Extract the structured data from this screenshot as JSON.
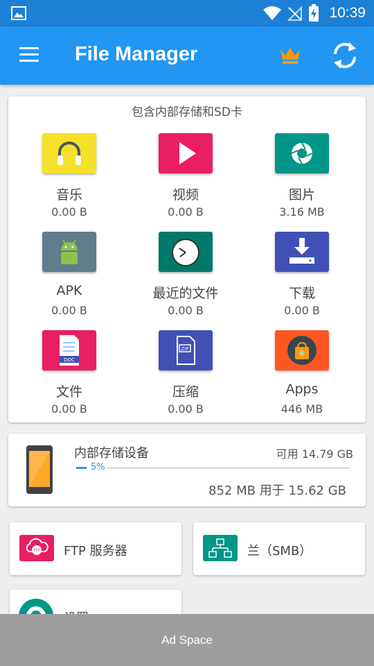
{
  "status_bar": {
    "time": "10:39"
  },
  "app_bar": {
    "title": "File Manager"
  },
  "categories": {
    "heading": "包含内部存储和SD卡",
    "items": [
      {
        "name": "音乐",
        "size": "0.00 B",
        "icon": "headphones-icon",
        "color": "#f5e12a"
      },
      {
        "name": "视频",
        "size": "0.00 B",
        "icon": "play-icon",
        "color": "#e91e63"
      },
      {
        "name": "图片",
        "size": "3.16 MB",
        "icon": "camera-shutter-icon",
        "color": "#009688"
      },
      {
        "name": "APK",
        "size": "0.00 B",
        "icon": "android-icon",
        "color": "#607d8b"
      },
      {
        "name": "最近的文件",
        "size": "0.00 B",
        "icon": "clock-icon",
        "color": "#00796b"
      },
      {
        "name": "下载",
        "size": "0.00 B",
        "icon": "download-icon",
        "color": "#3f51b5"
      },
      {
        "name": "文件",
        "size": "0.00 B",
        "icon": "document-icon",
        "color": "#e91e63"
      },
      {
        "name": "压缩",
        "size": "0.00 B",
        "icon": "zip-icon",
        "color": "#3f51b5"
      },
      {
        "name": "Apps",
        "size": "446 MB",
        "icon": "apps-icon",
        "color": "#ff5722"
      }
    ]
  },
  "storage": {
    "name": "内部存储设备",
    "available": "可用 14.79 GB",
    "percent_label": "5%",
    "percent_value": 5,
    "used": "852 MB 用于 15.62 GB"
  },
  "shortcuts": {
    "ftp": {
      "label": "FTP 服务器",
      "icon": "ftp-cloud-icon",
      "color": "#e91e63"
    },
    "smb": {
      "label": "兰（SMB）",
      "icon": "network-icon",
      "color": "#009688"
    },
    "settings": {
      "label": "设置",
      "icon": "gear-icon",
      "color": "#009688"
    }
  },
  "ad": {
    "label": "Ad Space"
  },
  "colors": {
    "primary": "#2196f3",
    "status_bar": "#1e7fd6",
    "crown": "#ff9800"
  }
}
